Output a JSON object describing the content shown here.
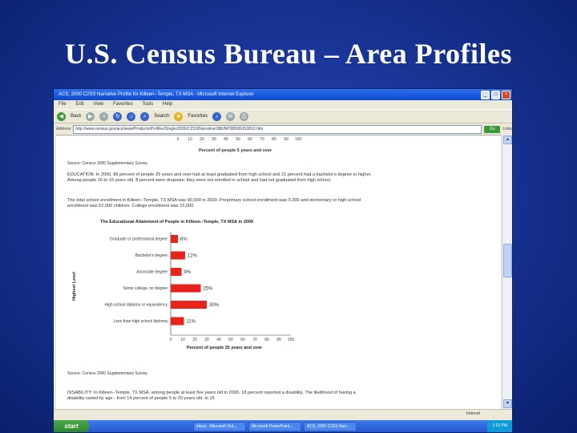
{
  "slide": {
    "title": "U.S. Census Bureau – Area Profiles"
  },
  "window": {
    "title": "ACS, 2000 C2SS Narrative Profile for Killeen--Temple, TX MSA - Microsoft Internet Explorer",
    "menu": [
      "File",
      "Edit",
      "View",
      "Favorites",
      "Tools",
      "Help"
    ],
    "toolbar": {
      "back": "Back",
      "search": "Search",
      "favorites": "Favorites"
    },
    "address_label": "Address",
    "address": "http://www.census.gov/acs/www/Products/Profiles/Single/2000/C2SS/Narrative/380/NP38000US3810.htm",
    "go_label": "Go",
    "links_label": "Links",
    "status_zone": "Internet"
  },
  "page": {
    "top_axis_ticks": [
      "0",
      "10",
      "20",
      "30",
      "40",
      "50",
      "60",
      "70",
      "80",
      "90",
      "100"
    ],
    "top_axis_title": "Percent of people 5 years and over",
    "top_source": "Source: Census 2000 Supplementary Survey",
    "education_para": "EDUCATION: In 2000, 86 percent of people 25 years and over had at least graduated from high school and 21 percent had a bachelor's degree or higher. Among people 16 to 19 years old, 8 percent were dropouts; they were not enrolled in school and had not graduated from high school.",
    "enrollment_para": "The total school enrollment in Killeen--Temple, TX MSA was 90,000 in 2000. Preprimary school enrollment was 9,300 and elementary or high school enrollment was 52,000 children. College enrollment was 15,000.",
    "bottom_source": "Source: Census 2000 Supplementary Survey",
    "disability_para": "DISABILITY: In Killeen--Temple, TX MSA, among people at least five years old in 2000, 18 percent reported a disability. The likelihood of having a disability varied by age - from 14 percent of people 5 to 20 years old, to 15"
  },
  "chart_data": {
    "type": "bar",
    "title": "The Educational Attainment of People in Killeen--Temple, TX MSA in 2000",
    "ylabel": "Highest Level",
    "xlabel": "Percent of people 25 years and over",
    "categories": [
      "Graduate or professional degree",
      "Bachelor's degree",
      "Associate degree",
      "Some college, no degree",
      "High school diploma or equivalency",
      "Less than high school diploma"
    ],
    "values": [
      6,
      12,
      9,
      25,
      30,
      11
    ],
    "data_labels": [
      "6%",
      "12%",
      "9%",
      "25%",
      "30%",
      "11%"
    ],
    "xlim": [
      0,
      100
    ],
    "xticks": [
      "0",
      "10",
      "20",
      "30",
      "40",
      "50",
      "60",
      "70",
      "80",
      "90",
      "100"
    ],
    "bar_color": "#e8231b"
  },
  "taskbar": {
    "start": "start",
    "items": [
      "Inbox - Microsoft Out...",
      "Microsoft PowerPoint...",
      "ACS, 2000 C2SS Narr..."
    ],
    "clock": "1:15 PM"
  }
}
